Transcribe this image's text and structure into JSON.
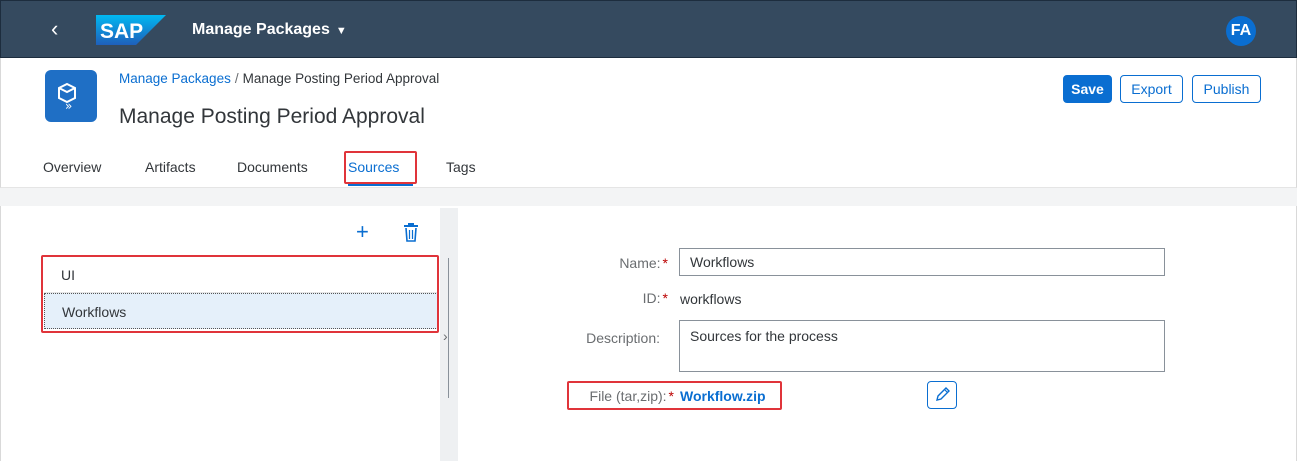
{
  "shell": {
    "back_icon": "chevron-left-icon",
    "logo_text": "SAP",
    "app_title": "Manage Packages",
    "app_title_caret": "▼",
    "avatar_initials": "FA"
  },
  "header": {
    "icon": "package-icon",
    "breadcrumb": {
      "link": "Manage Packages",
      "separator": "/",
      "current": "Manage Posting Period Approval"
    },
    "title": "Manage Posting Period Approval",
    "actions": {
      "save": "Save",
      "export": "Export",
      "publish": "Publish"
    },
    "tabs": [
      "Overview",
      "Artifacts",
      "Documents",
      "Sources",
      "Tags"
    ],
    "selected_tab": "Sources"
  },
  "sources": {
    "toolbar": {
      "add_icon": "add-icon",
      "delete_icon": "delete-icon"
    },
    "items": [
      "UI",
      "Workflows"
    ],
    "selected": "Workflows"
  },
  "form": {
    "name_label": "Name:",
    "name_value": "Workflows",
    "id_label": "ID:",
    "id_value": "workflows",
    "description_label": "Description:",
    "description_value": "Sources for the process",
    "file_label": "File (tar,zip):",
    "file_value": "Workflow.zip",
    "required_marker": "*",
    "edit_icon": "pencil-icon"
  },
  "colors": {
    "shell_bg": "#354a5f",
    "brand_blue": "#0a6ed1",
    "highlight_red": "#e0343a",
    "required_red": "#bb0000",
    "selected_row": "#e5f0fa"
  }
}
